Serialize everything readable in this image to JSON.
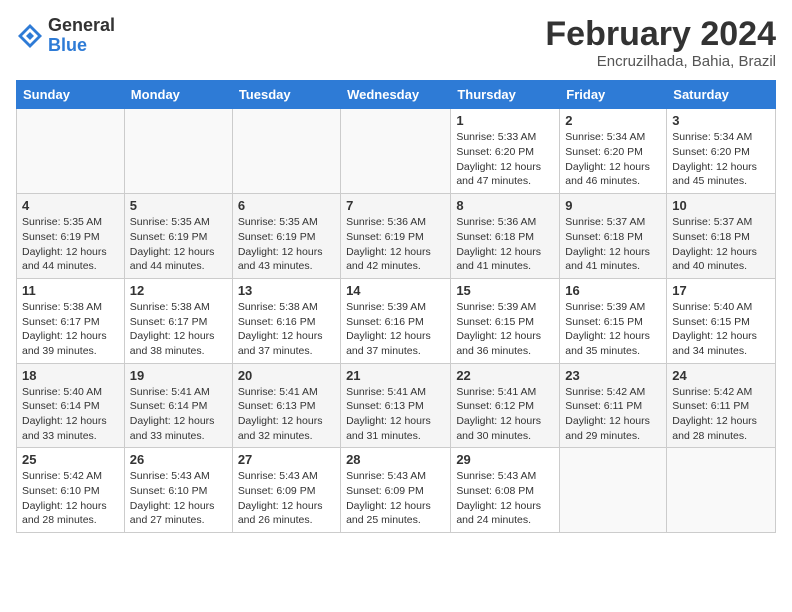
{
  "header": {
    "logo_general": "General",
    "logo_blue": "Blue",
    "month_title": "February 2024",
    "location": "Encruzilhada, Bahia, Brazil"
  },
  "days_of_week": [
    "Sunday",
    "Monday",
    "Tuesday",
    "Wednesday",
    "Thursday",
    "Friday",
    "Saturday"
  ],
  "weeks": [
    [
      {
        "num": "",
        "detail": ""
      },
      {
        "num": "",
        "detail": ""
      },
      {
        "num": "",
        "detail": ""
      },
      {
        "num": "",
        "detail": ""
      },
      {
        "num": "1",
        "detail": "Sunrise: 5:33 AM\nSunset: 6:20 PM\nDaylight: 12 hours\nand 47 minutes."
      },
      {
        "num": "2",
        "detail": "Sunrise: 5:34 AM\nSunset: 6:20 PM\nDaylight: 12 hours\nand 46 minutes."
      },
      {
        "num": "3",
        "detail": "Sunrise: 5:34 AM\nSunset: 6:20 PM\nDaylight: 12 hours\nand 45 minutes."
      }
    ],
    [
      {
        "num": "4",
        "detail": "Sunrise: 5:35 AM\nSunset: 6:19 PM\nDaylight: 12 hours\nand 44 minutes."
      },
      {
        "num": "5",
        "detail": "Sunrise: 5:35 AM\nSunset: 6:19 PM\nDaylight: 12 hours\nand 44 minutes."
      },
      {
        "num": "6",
        "detail": "Sunrise: 5:35 AM\nSunset: 6:19 PM\nDaylight: 12 hours\nand 43 minutes."
      },
      {
        "num": "7",
        "detail": "Sunrise: 5:36 AM\nSunset: 6:19 PM\nDaylight: 12 hours\nand 42 minutes."
      },
      {
        "num": "8",
        "detail": "Sunrise: 5:36 AM\nSunset: 6:18 PM\nDaylight: 12 hours\nand 41 minutes."
      },
      {
        "num": "9",
        "detail": "Sunrise: 5:37 AM\nSunset: 6:18 PM\nDaylight: 12 hours\nand 41 minutes."
      },
      {
        "num": "10",
        "detail": "Sunrise: 5:37 AM\nSunset: 6:18 PM\nDaylight: 12 hours\nand 40 minutes."
      }
    ],
    [
      {
        "num": "11",
        "detail": "Sunrise: 5:38 AM\nSunset: 6:17 PM\nDaylight: 12 hours\nand 39 minutes."
      },
      {
        "num": "12",
        "detail": "Sunrise: 5:38 AM\nSunset: 6:17 PM\nDaylight: 12 hours\nand 38 minutes."
      },
      {
        "num": "13",
        "detail": "Sunrise: 5:38 AM\nSunset: 6:16 PM\nDaylight: 12 hours\nand 37 minutes."
      },
      {
        "num": "14",
        "detail": "Sunrise: 5:39 AM\nSunset: 6:16 PM\nDaylight: 12 hours\nand 37 minutes."
      },
      {
        "num": "15",
        "detail": "Sunrise: 5:39 AM\nSunset: 6:15 PM\nDaylight: 12 hours\nand 36 minutes."
      },
      {
        "num": "16",
        "detail": "Sunrise: 5:39 AM\nSunset: 6:15 PM\nDaylight: 12 hours\nand 35 minutes."
      },
      {
        "num": "17",
        "detail": "Sunrise: 5:40 AM\nSunset: 6:15 PM\nDaylight: 12 hours\nand 34 minutes."
      }
    ],
    [
      {
        "num": "18",
        "detail": "Sunrise: 5:40 AM\nSunset: 6:14 PM\nDaylight: 12 hours\nand 33 minutes."
      },
      {
        "num": "19",
        "detail": "Sunrise: 5:41 AM\nSunset: 6:14 PM\nDaylight: 12 hours\nand 33 minutes."
      },
      {
        "num": "20",
        "detail": "Sunrise: 5:41 AM\nSunset: 6:13 PM\nDaylight: 12 hours\nand 32 minutes."
      },
      {
        "num": "21",
        "detail": "Sunrise: 5:41 AM\nSunset: 6:13 PM\nDaylight: 12 hours\nand 31 minutes."
      },
      {
        "num": "22",
        "detail": "Sunrise: 5:41 AM\nSunset: 6:12 PM\nDaylight: 12 hours\nand 30 minutes."
      },
      {
        "num": "23",
        "detail": "Sunrise: 5:42 AM\nSunset: 6:11 PM\nDaylight: 12 hours\nand 29 minutes."
      },
      {
        "num": "24",
        "detail": "Sunrise: 5:42 AM\nSunset: 6:11 PM\nDaylight: 12 hours\nand 28 minutes."
      }
    ],
    [
      {
        "num": "25",
        "detail": "Sunrise: 5:42 AM\nSunset: 6:10 PM\nDaylight: 12 hours\nand 28 minutes."
      },
      {
        "num": "26",
        "detail": "Sunrise: 5:43 AM\nSunset: 6:10 PM\nDaylight: 12 hours\nand 27 minutes."
      },
      {
        "num": "27",
        "detail": "Sunrise: 5:43 AM\nSunset: 6:09 PM\nDaylight: 12 hours\nand 26 minutes."
      },
      {
        "num": "28",
        "detail": "Sunrise: 5:43 AM\nSunset: 6:09 PM\nDaylight: 12 hours\nand 25 minutes."
      },
      {
        "num": "29",
        "detail": "Sunrise: 5:43 AM\nSunset: 6:08 PM\nDaylight: 12 hours\nand 24 minutes."
      },
      {
        "num": "",
        "detail": ""
      },
      {
        "num": "",
        "detail": ""
      }
    ]
  ]
}
